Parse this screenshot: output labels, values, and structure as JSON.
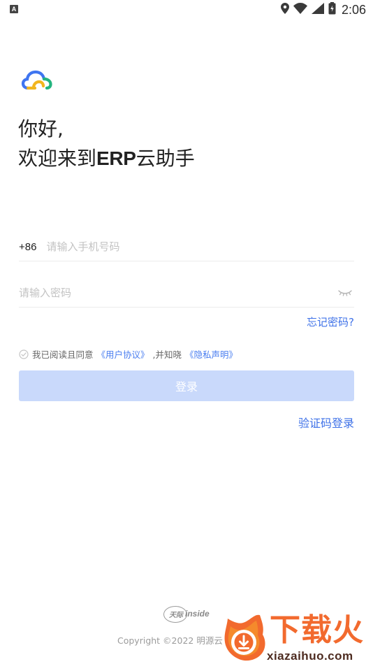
{
  "status_bar": {
    "left_indicator": "A",
    "icons": [
      "location-icon",
      "wifi-icon",
      "signal-icon",
      "battery-icon"
    ],
    "time": "2:06"
  },
  "brand": {
    "logo_icon": "cloud-logo-icon"
  },
  "headline": {
    "greeting": "你好,",
    "welcome_prefix": "欢迎来到",
    "app_name": "ERP",
    "welcome_suffix": "云助手"
  },
  "form": {
    "country_code": "+86",
    "phone_placeholder": "请输入手机号码",
    "phone_value": "",
    "password_placeholder": "请输入密码",
    "password_value": "",
    "password_toggle_icon": "eye-closed-icon",
    "forgot_password": "忘记密码?"
  },
  "agreement": {
    "checked": false,
    "prefix": "我已阅读且同意",
    "user_agreement": "《用户协议》",
    "middle": ",并知晓",
    "privacy": "《隐私声明》"
  },
  "actions": {
    "login_label": "登录",
    "sms_login_label": "验证码登录"
  },
  "footer": {
    "tianji_brand": "天际",
    "tianji_suffix": "inside",
    "copyright": "Copyright ©2022 明源云"
  },
  "watermark": {
    "title": "下载火",
    "domain": "xiazaihuo.com"
  },
  "colors": {
    "accent": "#3f72e8",
    "button_disabled": "#c9d9fb",
    "watermark_orange": "#f26a2e"
  }
}
